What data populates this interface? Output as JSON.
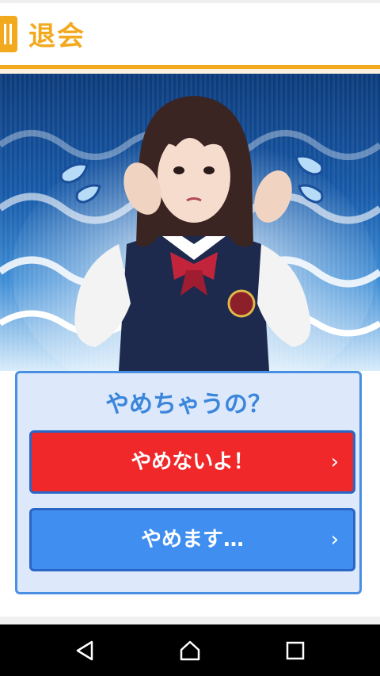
{
  "header": {
    "title": "退会"
  },
  "dialog": {
    "question": "やめちゃうの？",
    "stay_button_label": "やめないよ！",
    "quit_button_label": "やめます…",
    "chevron": "›"
  },
  "colors": {
    "accent_orange": "#f2a91e",
    "dialog_border": "#4a90e2",
    "stay_button": "#f0282a",
    "quit_button": "#3f8ef0"
  },
  "icons": {
    "nav_back": "back-icon",
    "nav_home": "home-icon",
    "nav_recent": "recent-apps-icon"
  }
}
